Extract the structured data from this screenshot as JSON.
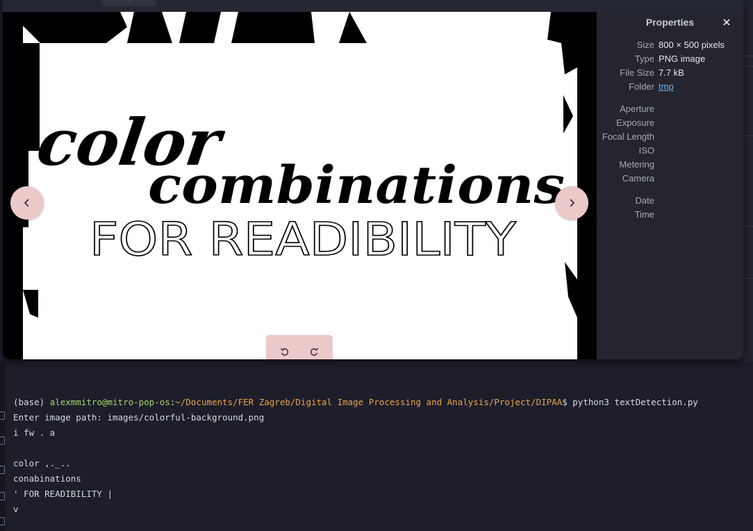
{
  "terminal": {
    "prompt_env": "(base) ",
    "prompt_user": "alexmmitro@mitro-pop-os",
    "prompt_path": "~/Documents/FER Zagreb/Digital Image Processing and Analysis/Project/DIPAA",
    "prompt_cmd": "$ python3 textDetection.py",
    "output_lines": [
      "Enter image path: images/colorful-background.png",
      "i fw . a",
      "",
      "color ,._..",
      "conabinations",
      "' FOR READIBILITY |",
      "v"
    ]
  },
  "viewer": {
    "image_text": {
      "line1": "color",
      "line2": "combinations",
      "line3": "FOR READIBILITY"
    },
    "prev_icon": "chevron-left-icon",
    "next_icon": "chevron-right-icon",
    "rotate_left_icon": "rotate-left-icon",
    "rotate_right_icon": "rotate-right-icon",
    "button_color": "#ecc9c9"
  },
  "properties": {
    "title": "Properties",
    "close_icon": "close-icon",
    "rows": [
      {
        "key": "Size",
        "value": "800 × 500 pixels"
      },
      {
        "key": "Type",
        "value": "PNG image"
      },
      {
        "key": "File Size",
        "value": "7.7 kB"
      },
      {
        "key": "Folder",
        "value": "tmp"
      },
      {
        "key": "Aperture",
        "value": ""
      },
      {
        "key": "Exposure",
        "value": ""
      },
      {
        "key": "Focal Length",
        "value": ""
      },
      {
        "key": "ISO",
        "value": ""
      },
      {
        "key": "Metering",
        "value": ""
      },
      {
        "key": "Camera",
        "value": ""
      },
      {
        "key": "Date",
        "value": ""
      },
      {
        "key": "Time",
        "value": ""
      }
    ]
  }
}
